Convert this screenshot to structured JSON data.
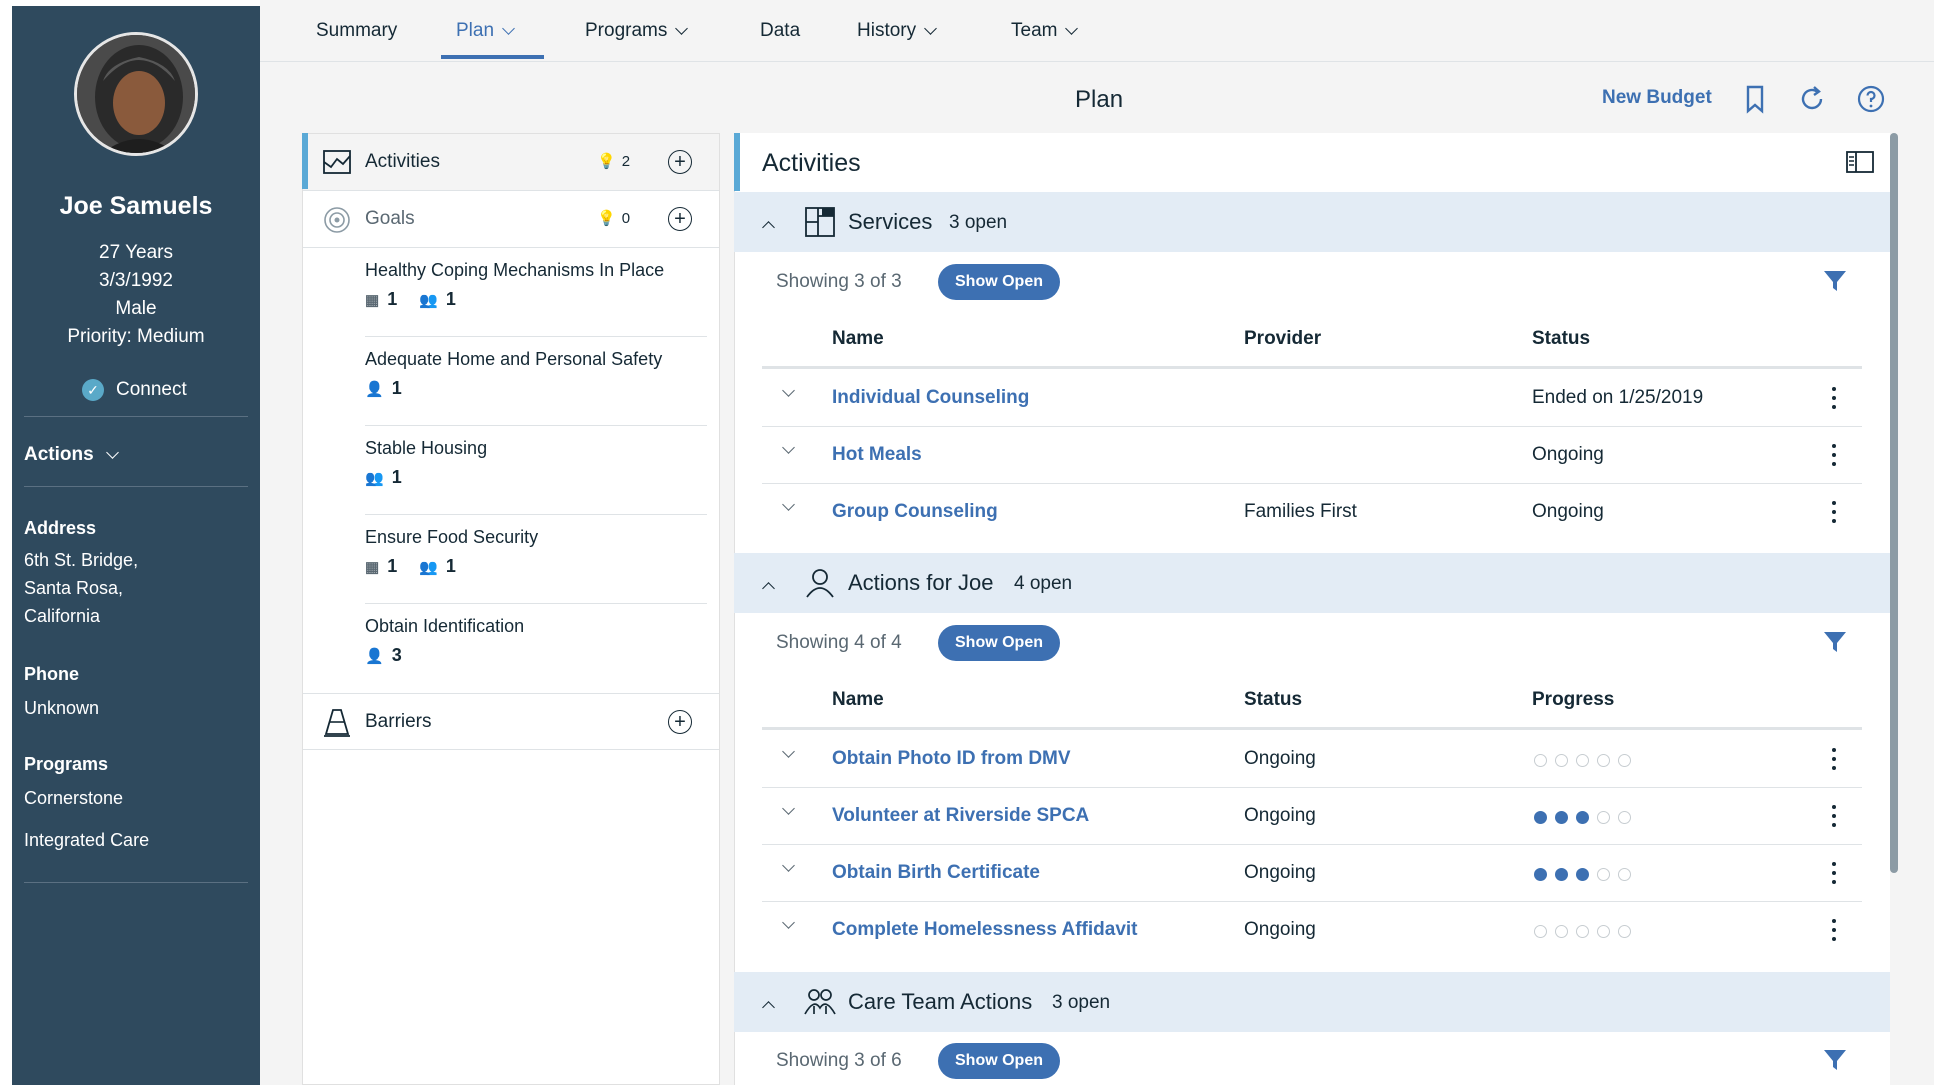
{
  "patient": {
    "name": "Joe Samuels",
    "age": "27 Years",
    "dob": "3/3/1992",
    "gender": "Male",
    "priority": "Priority: Medium",
    "connect": "Connect",
    "actions": "Actions",
    "address_label": "Address",
    "address_lines": [
      "6th St. Bridge,",
      "Santa Rosa,",
      "California"
    ],
    "phone_label": "Phone",
    "phone": "Unknown",
    "programs_label": "Programs",
    "programs": [
      "Cornerstone",
      "Integrated Care"
    ]
  },
  "nav": {
    "tabs": [
      "Summary",
      "Plan",
      "Programs",
      "Data",
      "History",
      "Team"
    ]
  },
  "header": {
    "title": "Plan",
    "new_budget": "New Budget"
  },
  "left": {
    "activities": {
      "label": "Activities",
      "count": "2"
    },
    "goals": {
      "label": "Goals",
      "count": "0"
    },
    "goal_items": [
      {
        "title": "Healthy Coping Mechanisms In Place",
        "a": "1",
        "b": "1"
      },
      {
        "title": "Adequate Home and Personal Safety",
        "a": "1"
      },
      {
        "title": "Stable Housing",
        "a": "1"
      },
      {
        "title": "Ensure Food Security",
        "a": "1",
        "b": "1"
      },
      {
        "title": "Obtain Identification",
        "a": "3"
      }
    ],
    "barriers": "Barriers"
  },
  "activities": {
    "title": "Activities",
    "sections": [
      {
        "title": "Services",
        "open": "3 open",
        "showing": "Showing 3 of 3",
        "show_open": "Show Open",
        "columns": [
          "Name",
          "Provider",
          "Status"
        ],
        "rows": [
          {
            "name": "Individual Counseling",
            "provider": "",
            "status": "Ended on 1/25/2019"
          },
          {
            "name": "Hot Meals",
            "provider": "",
            "status": "Ongoing"
          },
          {
            "name": "Group Counseling",
            "provider": "Families First",
            "status": "Ongoing"
          }
        ]
      },
      {
        "title": "Actions for Joe",
        "open": "4 open",
        "showing": "Showing 4 of 4",
        "show_open": "Show Open",
        "columns": [
          "Name",
          "Status",
          "Progress"
        ],
        "rows": [
          {
            "name": "Obtain Photo ID from DMV",
            "status": "Ongoing",
            "progress": 0
          },
          {
            "name": "Volunteer at Riverside SPCA",
            "status": "Ongoing",
            "progress": 3
          },
          {
            "name": "Obtain Birth Certificate",
            "status": "Ongoing",
            "progress": 3
          },
          {
            "name": "Complete Homelessness Affidavit",
            "status": "Ongoing",
            "progress": 0
          }
        ]
      },
      {
        "title": "Care Team Actions",
        "open": "3 open",
        "showing": "Showing 3 of 6",
        "show_open": "Show Open"
      }
    ]
  },
  "colors": {
    "accent": "#3d70b2",
    "sidebar": "#2f4a5e",
    "section_bg": "#e3ecf5"
  }
}
